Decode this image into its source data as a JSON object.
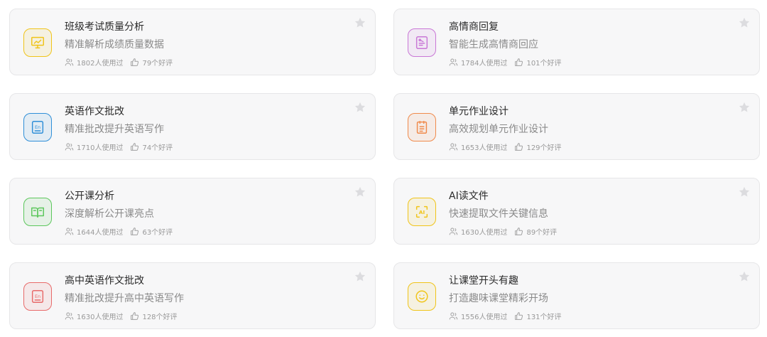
{
  "cards": [
    {
      "title": "班级考试质量分析",
      "desc": "精准解析成绩质量数据",
      "users": "1802人使用过",
      "likes": "79个好评",
      "icon": "presentation-chart-icon",
      "color": "#f0c419"
    },
    {
      "title": "高情商回复",
      "desc": "智能生成高情商回应",
      "users": "1784人使用过",
      "likes": "101个好评",
      "icon": "chat-reply-icon",
      "color": "#c977d6"
    },
    {
      "title": "英语作文批改",
      "desc": "精准批改提升英语写作",
      "users": "1710人使用过",
      "likes": "74个好评",
      "icon": "english-doc-icon",
      "color": "#2f8fd8"
    },
    {
      "title": "单元作业设计",
      "desc": "高效规划单元作业设计",
      "users": "1653人使用过",
      "likes": "129个好评",
      "icon": "clipboard-list-icon",
      "color": "#f08a4b"
    },
    {
      "title": "公开课分析",
      "desc": "深度解析公开课亮点",
      "users": "1644人使用过",
      "likes": "63个好评",
      "icon": "open-book-icon",
      "color": "#5cc75c"
    },
    {
      "title": "AI读文件",
      "desc": "快速提取文件关键信息",
      "users": "1630人使用过",
      "likes": "89个好评",
      "icon": "ai-scan-icon",
      "color": "#f0c419"
    },
    {
      "title": "高中英语作文批改",
      "desc": "精准批改提升高中英语写作",
      "users": "1630人使用过",
      "likes": "128个好评",
      "icon": "english-doc-icon",
      "color": "#e86a6a"
    },
    {
      "title": "让课堂开头有趣",
      "desc": "打造趣味课堂精彩开场",
      "users": "1556人使用过",
      "likes": "131个好评",
      "icon": "smile-icon",
      "color": "#f0c419"
    }
  ]
}
